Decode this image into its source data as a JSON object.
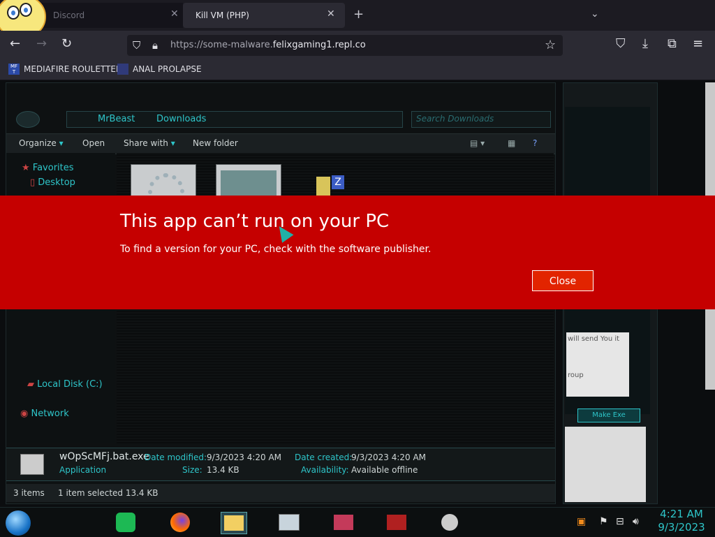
{
  "browser": {
    "tabs": [
      {
        "title": "Discord",
        "close": "✕"
      },
      {
        "title": "Kill VM (PHP)",
        "close": "✕"
      }
    ],
    "new_tab": "+",
    "tab_list": "⌄",
    "url_prefix": "https://some-malware.",
    "url_domain": "felixgaming1.repl.co",
    "bookmarks": [
      {
        "icon_text": "MF T",
        "label": "MEDIAFIRE ROULETTER"
      },
      {
        "label": "ANAL PROLAPSE"
      }
    ]
  },
  "explorer": {
    "breadcrumb": [
      "MrBeast",
      "Downloads"
    ],
    "search_placeholder": "Search Downloads",
    "toolbar": [
      "Organize",
      "Share with",
      "New folder"
    ],
    "toolbar_open": "Open",
    "sidebar": {
      "favorites": "Favorites",
      "desktop": "Desktop",
      "local_disk": "Local Disk (C:)",
      "network": "Network"
    },
    "details": {
      "file_name": "wOpScMFj.bat.exe",
      "type": "Application",
      "date_modified_label": "Date modified:",
      "date_modified": "9/3/2023 4:20 AM",
      "size_label": "Size:",
      "size": "13.4 KB",
      "date_created_label": "Date created:",
      "date_created": "9/3/2023 4:20 AM",
      "availability_label": "Availability:",
      "availability": "Available offline"
    },
    "status": {
      "items": "3 items",
      "selected": "1 item selected  13.4 KB"
    }
  },
  "gadget": {
    "text1": "will send You it",
    "text2": "roup",
    "button": "Make Exe"
  },
  "dialog": {
    "title": "This app can’t run on your PC",
    "message": "To find a version for your PC, check with the software publisher.",
    "close_label": "Close"
  },
  "taskbar": {
    "time": "4:21 AM",
    "date": "9/3/2023"
  },
  "colors": {
    "dialog_bg": "#c50000",
    "accent": "#2ec5c9"
  }
}
